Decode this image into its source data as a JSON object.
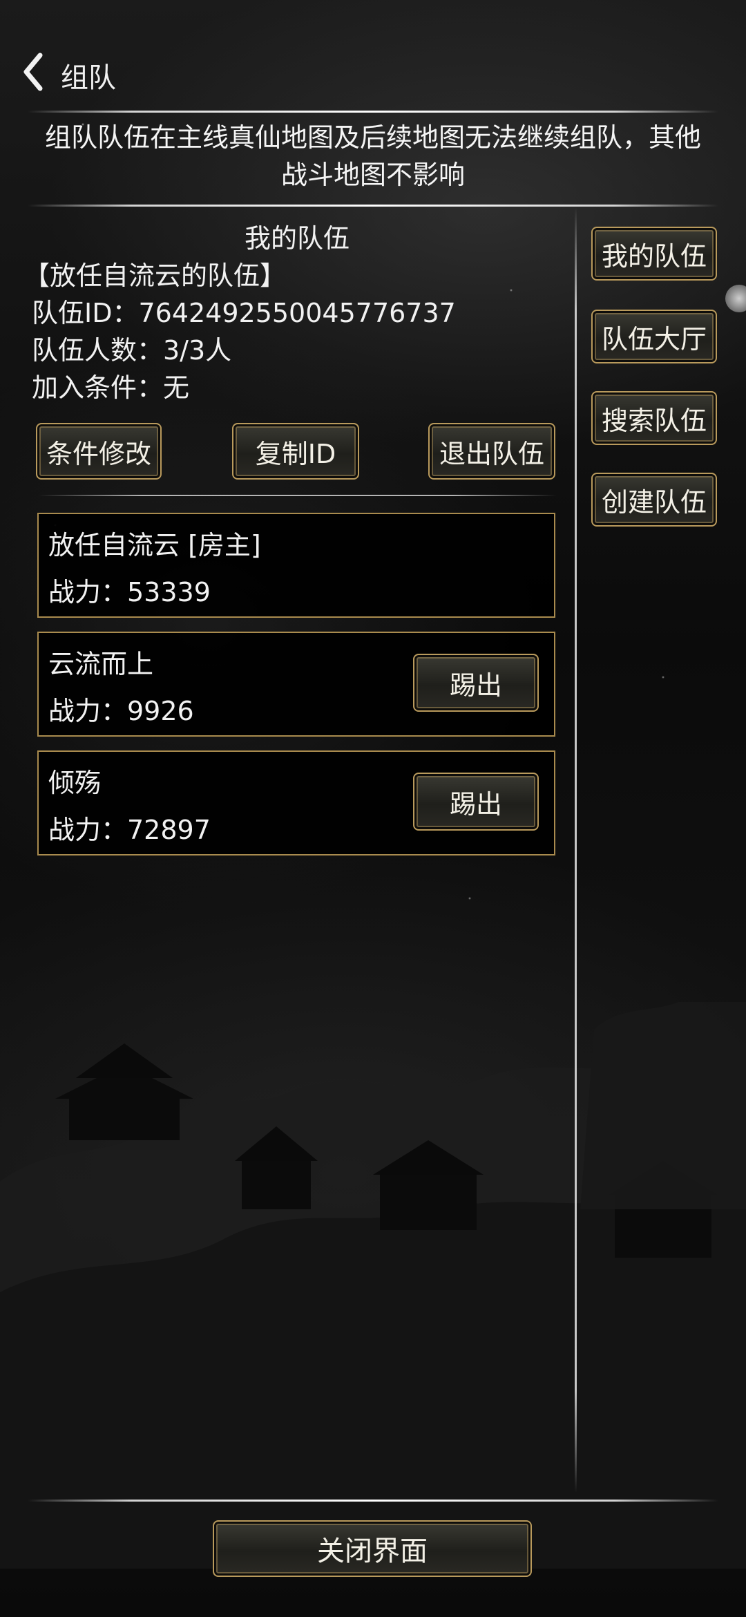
{
  "header": {
    "title": "组队",
    "back_icon": "chevron-left-icon"
  },
  "notice": {
    "line1": "组队队伍在主线真仙地图及后续地图无法继续组队，其他",
    "line2": "战斗地图不影响"
  },
  "my_team": {
    "section_title": "我的队伍",
    "team_name": "【放任自流云的队伍】",
    "team_id_line": "队伍ID：7642492550045776737",
    "member_count_line": "队伍人数：3/3人",
    "join_condition_line": "加入条件：无"
  },
  "actions": {
    "edit_condition": "条件修改",
    "copy_id": "复制ID",
    "leave_team": "退出队伍"
  },
  "members": [
    {
      "name": "放任自流云 [房主]",
      "power": "战力：53339",
      "kick_label": ""
    },
    {
      "name": "云流而上",
      "power": "战力：9926",
      "kick_label": "踢出"
    },
    {
      "name": "倾殇",
      "power": "战力：72897",
      "kick_label": "踢出"
    }
  ],
  "side_tabs": [
    {
      "label": "我的队伍"
    },
    {
      "label": "队伍大厅"
    },
    {
      "label": "搜索队伍"
    },
    {
      "label": "创建队伍"
    }
  ],
  "footer": {
    "close_label": "关闭界面"
  },
  "colors": {
    "button_border": "#b99a5c",
    "card_border": "#a98b4e"
  }
}
